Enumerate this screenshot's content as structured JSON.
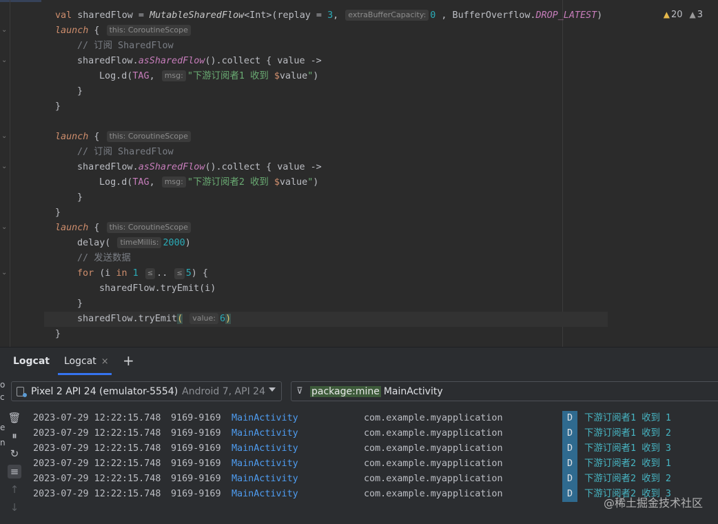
{
  "editor": {
    "inspections": {
      "warnings": "20",
      "weak_warnings": "3"
    },
    "hints": {
      "scope": "this: CoroutineScope",
      "extra_capacity": "extraBufferCapacity:",
      "msg": "msg:",
      "time_millis": "timeMillis:",
      "value": "value:",
      "le": "≤"
    }
  },
  "logcat": {
    "tool_title": "Logcat",
    "tab_label": "Logcat",
    "tab_close": "×",
    "add_tab": "+",
    "device": {
      "name": "Pixel 2 API 24 (emulator-5554)",
      "details": "Android 7, API 24"
    },
    "filter": {
      "chip": "package:mine",
      "text": "MainActivity"
    },
    "left_edge": [
      "o",
      "c",
      "e",
      "n"
    ],
    "rows": [
      {
        "time": "2023-07-29 12:22:15.748",
        "pid": "9169-9169",
        "tag": "MainActivity",
        "pkg": "com.example.myapplication",
        "level": "D",
        "msg": "下游订阅者1 收到 1"
      },
      {
        "time": "2023-07-29 12:22:15.748",
        "pid": "9169-9169",
        "tag": "MainActivity",
        "pkg": "com.example.myapplication",
        "level": "D",
        "msg": "下游订阅者1 收到 2"
      },
      {
        "time": "2023-07-29 12:22:15.748",
        "pid": "9169-9169",
        "tag": "MainActivity",
        "pkg": "com.example.myapplication",
        "level": "D",
        "msg": "下游订阅者1 收到 3"
      },
      {
        "time": "2023-07-29 12:22:15.748",
        "pid": "9169-9169",
        "tag": "MainActivity",
        "pkg": "com.example.myapplication",
        "level": "D",
        "msg": "下游订阅者2 收到 1"
      },
      {
        "time": "2023-07-29 12:22:15.748",
        "pid": "9169-9169",
        "tag": "MainActivity",
        "pkg": "com.example.myapplication",
        "level": "D",
        "msg": "下游订阅者2 收到 2"
      },
      {
        "time": "2023-07-29 12:22:15.748",
        "pid": "9169-9169",
        "tag": "MainActivity",
        "pkg": "com.example.myapplication",
        "level": "D",
        "msg": "下游订阅者2 收到 3"
      }
    ]
  },
  "watermark": "@稀土掘金技术社区",
  "colors": {
    "accent": "#3574f0",
    "level_badge": "#2f6a8f",
    "tag": "#4e9cf0",
    "message": "#47b6c4"
  },
  "icons": [
    "trash-icon",
    "pause-icon",
    "restart-icon",
    "soft-wrap-icon",
    "scroll-up-icon",
    "scroll-down-icon",
    "device-icon",
    "filter-icon",
    "warning-icon"
  ]
}
